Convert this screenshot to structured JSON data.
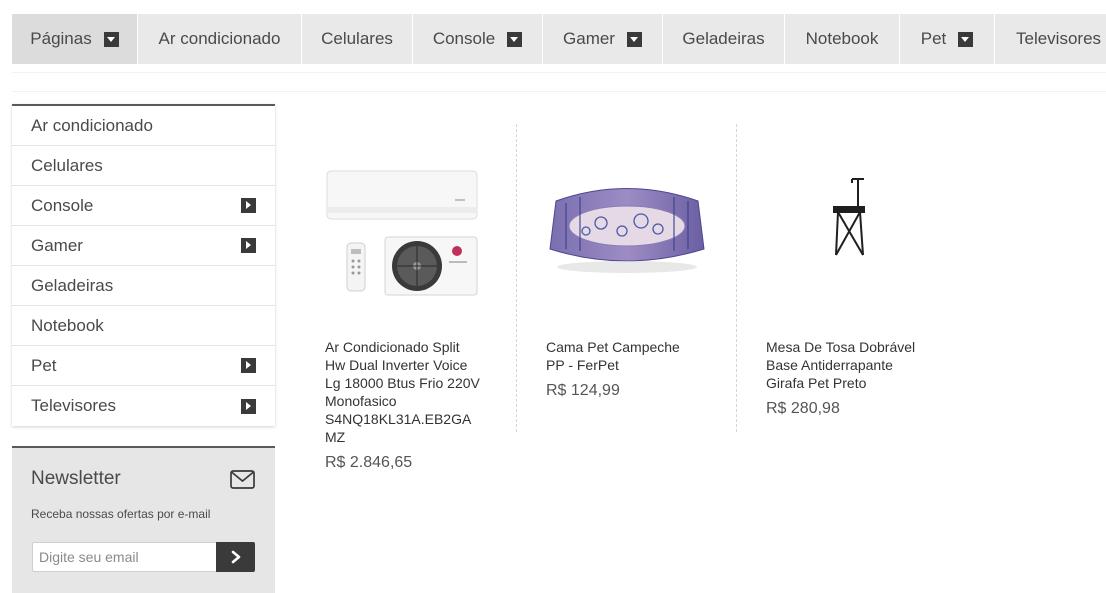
{
  "topnav": [
    {
      "label": "Páginas",
      "dropdown": true,
      "active": true
    },
    {
      "label": "Ar condicionado",
      "dropdown": false
    },
    {
      "label": "Celulares",
      "dropdown": false
    },
    {
      "label": "Console",
      "dropdown": true
    },
    {
      "label": "Gamer",
      "dropdown": true
    },
    {
      "label": "Geladeiras",
      "dropdown": false
    },
    {
      "label": "Notebook",
      "dropdown": false
    },
    {
      "label": "Pet",
      "dropdown": true
    },
    {
      "label": "Televisores",
      "dropdown": false
    }
  ],
  "sidebar": {
    "items": [
      {
        "label": "Ar condicionado",
        "submenu": false
      },
      {
        "label": "Celulares",
        "submenu": false
      },
      {
        "label": "Console",
        "submenu": true
      },
      {
        "label": "Gamer",
        "submenu": true
      },
      {
        "label": "Geladeiras",
        "submenu": false
      },
      {
        "label": "Notebook",
        "submenu": false
      },
      {
        "label": "Pet",
        "submenu": true
      },
      {
        "label": "Televisores",
        "submenu": true
      }
    ]
  },
  "newsletter": {
    "title": "Newsletter",
    "description": "Receba nossas ofertas por e-mail",
    "placeholder": "Digite seu email",
    "icon": "mail-icon"
  },
  "products": [
    {
      "name": "Ar Condicionado Split Hw Dual Inverter Voice Lg 18000 Btus Frio 220V Monofasico S4NQ18KL31A.EB2GAMZ",
      "price": "R$ 2.846,65",
      "image": "air-conditioner"
    },
    {
      "name": "Cama Pet Campeche PP - FerPet",
      "price": "R$ 124,99",
      "image": "pet-bed"
    },
    {
      "name": "Mesa De Tosa Dobrável Base Antiderrapante Girafa Pet Preto",
      "price": "R$ 280,98",
      "image": "grooming-table"
    }
  ]
}
